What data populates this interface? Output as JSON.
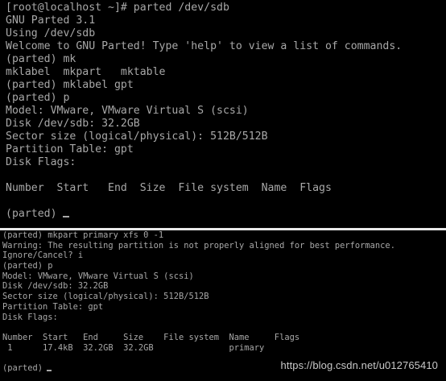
{
  "top_terminal": {
    "lines": [
      "[root@localhost ~]# parted /dev/sdb",
      "GNU Parted 3.1",
      "Using /dev/sdb",
      "Welcome to GNU Parted! Type 'help' to view a list of commands.",
      "(parted) mk",
      "mklabel  mkpart   mktable",
      "(parted) mklabel gpt",
      "(parted) p",
      "Model: VMware, VMware Virtual S (scsi)",
      "Disk /dev/sdb: 32.2GB",
      "Sector size (logical/physical): 512B/512B",
      "Partition Table: gpt",
      "Disk Flags:",
      "",
      "Number  Start   End  Size  File system  Name  Flags",
      "",
      "(parted)"
    ]
  },
  "bottom_terminal": {
    "lines": [
      "(parted) mkpart primary xfs 0 -1",
      "Warning: The resulting partition is not properly aligned for best performance.",
      "Ignore/Cancel? i",
      "(parted) p",
      "Model: VMware, VMware Virtual S (scsi)",
      "Disk /dev/sdb: 32.2GB",
      "Sector size (logical/physical): 512B/512B",
      "Partition Table: gpt",
      "Disk Flags:",
      "",
      "Number  Start   End     Size    File system  Name     Flags",
      " 1      17.4kB  32.2GB  32.2GB               primary",
      "",
      "(parted)"
    ]
  },
  "watermark": "https://blog.csdn.net/u012765410",
  "colors": {
    "background": "#000000",
    "text": "#a8a8a8",
    "divider": "#e8e8e8"
  }
}
